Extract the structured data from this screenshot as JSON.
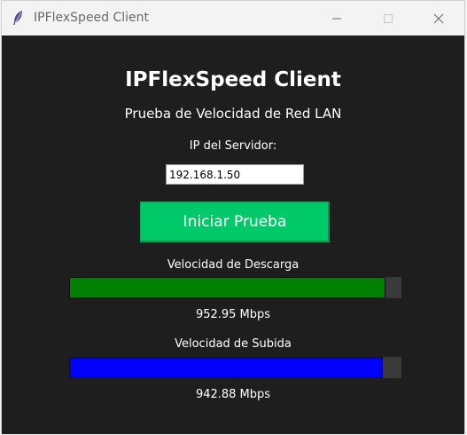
{
  "window": {
    "title": "IPFlexSpeed Client"
  },
  "app": {
    "heading": "IPFlexSpeed Client",
    "subtitle": "Prueba de Velocidad de Red LAN",
    "ip_label": "IP del Servidor:",
    "ip_value": "192.168.1.50",
    "start_button": "Iniciar Prueba"
  },
  "download": {
    "label": "Velocidad de Descarga",
    "value_text": "952.95 Mbps",
    "progress_percent": 95.3,
    "color": "#008000"
  },
  "upload": {
    "label": "Velocidad de Subida",
    "value_text": "942.88 Mbps",
    "progress_percent": 94.3,
    "color": "#0000ff"
  },
  "colors": {
    "background": "#1e1e1e",
    "button": "#00c96a",
    "text": "#ffffff"
  },
  "icons": [
    "feather-icon",
    "minimize-icon",
    "maximize-icon",
    "close-icon"
  ]
}
